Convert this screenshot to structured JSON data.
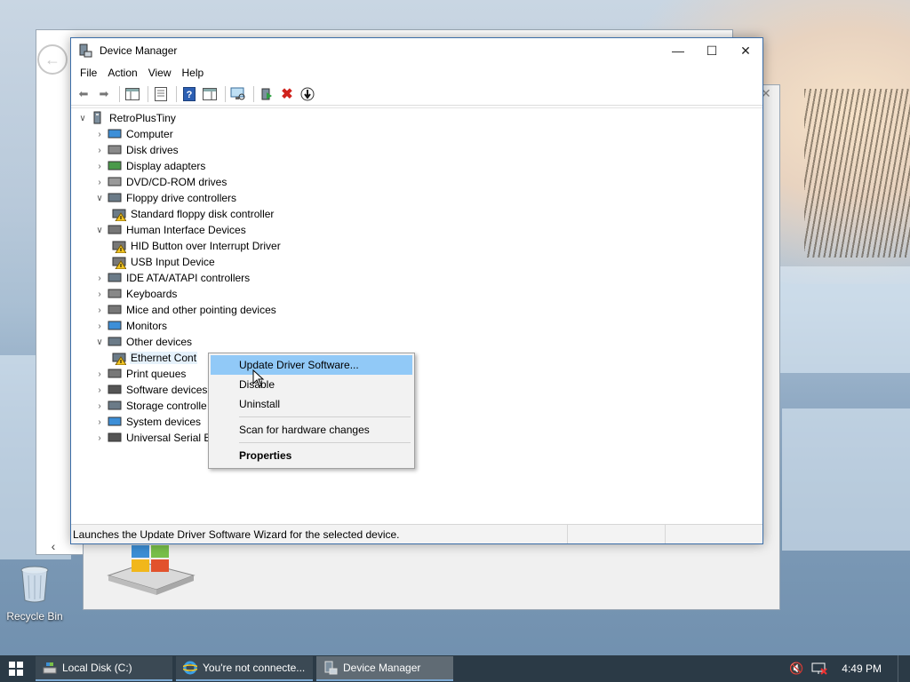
{
  "window": {
    "title": "Device Manager",
    "minimize": "—",
    "maximize": "☐",
    "close": "✕"
  },
  "menu": [
    "File",
    "Action",
    "View",
    "Help"
  ],
  "toolbar": {
    "icons": [
      "back-arrow",
      "forward-arrow",
      "show-hide-console-tree",
      "properties",
      "help",
      "action-pane",
      "scan-hardware",
      "update-driver",
      "uninstall-device",
      "disable-device"
    ]
  },
  "tree": {
    "root": "RetroPlusTiny",
    "items": [
      {
        "label": "Computer",
        "expanded": false,
        "icon": "computer-icon"
      },
      {
        "label": "Disk drives",
        "expanded": false,
        "icon": "disk-drive-icon"
      },
      {
        "label": "Display adapters",
        "expanded": false,
        "icon": "display-adapter-icon"
      },
      {
        "label": "DVD/CD-ROM drives",
        "expanded": false,
        "icon": "dvd-drive-icon"
      },
      {
        "label": "Floppy drive controllers",
        "expanded": true,
        "icon": "floppy-controller-icon"
      },
      {
        "label": "Standard floppy disk controller",
        "child": true,
        "warning": true,
        "icon": "floppy-controller-icon"
      },
      {
        "label": "Human Interface Devices",
        "expanded": true,
        "icon": "hid-icon"
      },
      {
        "label": "HID Button over Interrupt Driver",
        "child": true,
        "warning": true,
        "icon": "hid-icon"
      },
      {
        "label": "USB Input Device",
        "child": true,
        "warning": true,
        "icon": "hid-icon"
      },
      {
        "label": "IDE ATA/ATAPI controllers",
        "expanded": false,
        "icon": "ide-controller-icon"
      },
      {
        "label": "Keyboards",
        "expanded": false,
        "icon": "keyboard-icon"
      },
      {
        "label": "Mice and other pointing devices",
        "expanded": false,
        "icon": "mouse-icon"
      },
      {
        "label": "Monitors",
        "expanded": false,
        "icon": "monitor-icon"
      },
      {
        "label": "Other devices",
        "expanded": true,
        "icon": "unknown-device-icon"
      },
      {
        "label": "Ethernet Cont",
        "child": true,
        "warning": true,
        "selected": true,
        "icon": "ethernet-icon"
      },
      {
        "label": "Print queues",
        "expanded": false,
        "icon": "printer-icon"
      },
      {
        "label": "Software devices",
        "expanded": false,
        "icon": "software-device-icon"
      },
      {
        "label": "Storage controlle",
        "expanded": false,
        "icon": "storage-controller-icon"
      },
      {
        "label": "System devices",
        "expanded": false,
        "icon": "system-device-icon"
      },
      {
        "label": "Universal Serial Bu",
        "expanded": false,
        "icon": "usb-icon"
      }
    ]
  },
  "context_menu": {
    "update": "Update Driver Software...",
    "disable": "Disable",
    "uninstall": "Uninstall",
    "scan": "Scan for hardware changes",
    "properties": "Properties"
  },
  "status": "Launches the Update Driver Software Wizard for the selected device.",
  "desktop": {
    "recycle_bin": "Recycle Bin"
  },
  "taskbar": {
    "items": [
      "Local Disk (C:)",
      "You're not connecte...",
      "Device Manager"
    ],
    "clock": "4:49 PM"
  },
  "colors": {
    "accent": "#91c9f7",
    "selection": "#e5f1fb",
    "taskbar": "#2b3a46"
  }
}
